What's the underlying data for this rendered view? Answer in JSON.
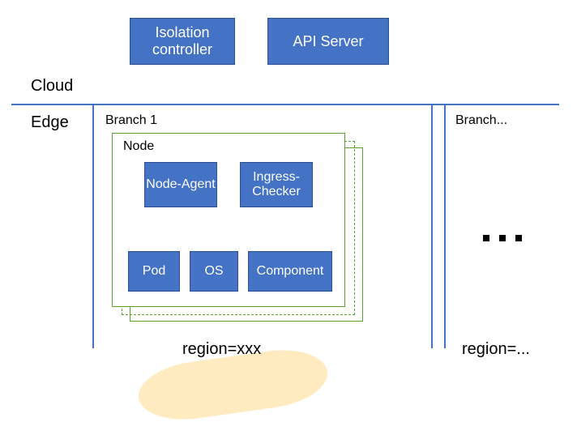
{
  "cloud": {
    "label": "Cloud",
    "boxes": {
      "isolation_controller": "Isolation controller",
      "api_server": "API Server"
    }
  },
  "edge": {
    "label": "Edge",
    "branch1": {
      "title": "Branch 1",
      "node": {
        "title": "Node",
        "components": {
          "node_agent": "Node-Agent",
          "ingress_checker": "Ingress-Checker",
          "pod": "Pod",
          "os": "OS",
          "component": "Component"
        }
      },
      "region_label": "region=xxx"
    },
    "branch_more": {
      "title": "Branch...",
      "ellipsis": "...",
      "region_label": "region=..."
    }
  },
  "colors": {
    "box_fill": "#4472c4",
    "box_border": "#2f528f",
    "line": "#4472c4",
    "node_border": "#5aa02c",
    "highlight": "#ffe9b8"
  }
}
